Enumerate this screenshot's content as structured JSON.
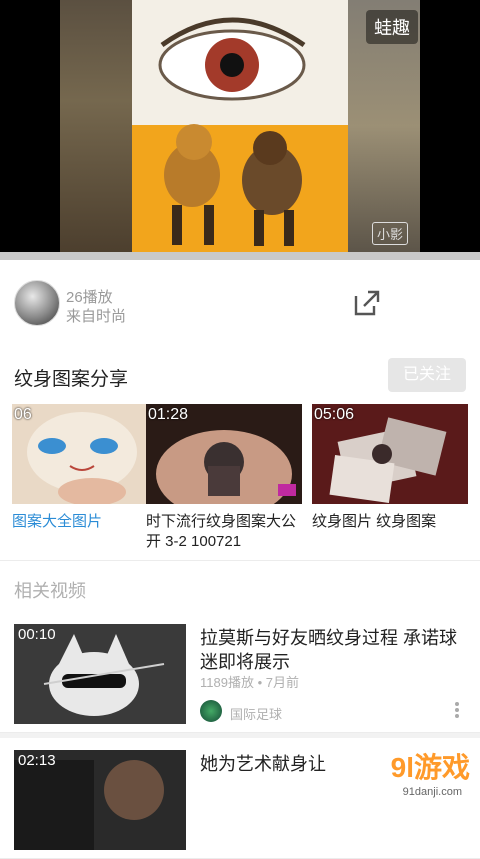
{
  "player": {
    "watermark": "蛙趣",
    "logo_text": "小影"
  },
  "info": {
    "plays": "26播放",
    "source": "来自时尚"
  },
  "album": {
    "title": "纹身图案分享",
    "follow_label": "已关注",
    "items": [
      {
        "time": "06",
        "caption": "图案大全图片",
        "caption_color": "#2b8cd6"
      },
      {
        "time": "01:28",
        "caption": "时下流行纹身图案大公开 3-2 100721",
        "caption_color": "#222222"
      },
      {
        "time": "05:06",
        "caption": "纹身图片 纹身图案",
        "caption_color": "#222222"
      }
    ]
  },
  "related": {
    "heading": "相关视频",
    "videos": [
      {
        "time": "00:10",
        "title": "拉莫斯与好友晒纹身过程 承诺球迷即将展示",
        "meta": "1189播放 • 7月前",
        "channel": "国际足球"
      },
      {
        "time": "02:13",
        "title": "她为艺术献身让",
        "meta": "",
        "channel": ""
      }
    ]
  },
  "brand": {
    "name": "9l游戏",
    "url": "91danji.com"
  }
}
